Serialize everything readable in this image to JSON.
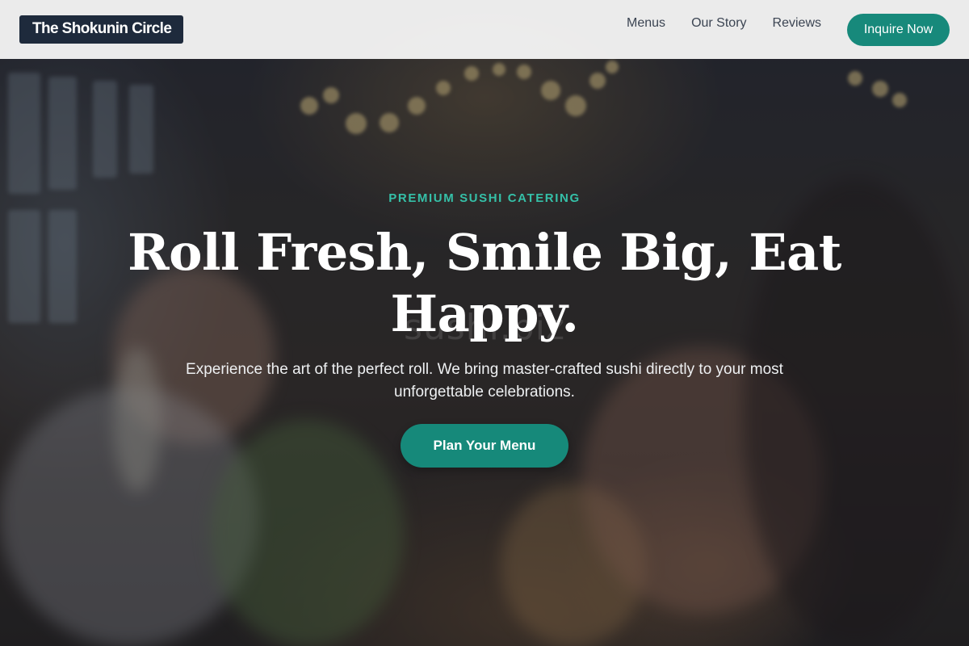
{
  "header": {
    "logo_text": "The Shokunin Circle",
    "nav_links": [
      "Menus",
      "Our Story",
      "Reviews"
    ],
    "cta_label": "Inquire Now"
  },
  "hero": {
    "eyebrow": "PREMIUM SUSHI CATERING",
    "headline": "Roll Fresh, Smile Big, Eat Happy.",
    "watermark": "sushi.biz",
    "subtext": "Experience the art of the perfect roll. We bring master-crafted sushi directly to your most unforgettable celebrations.",
    "cta_label": "Plan Your Menu",
    "background_image": "celebration-toast-photo"
  },
  "colors": {
    "accent": "#17897b",
    "eyebrow": "#35c0a8",
    "logo_bg": "#1e2a3c",
    "nav_bg": "#f4f4f4",
    "nav_text": "#3b4452"
  }
}
